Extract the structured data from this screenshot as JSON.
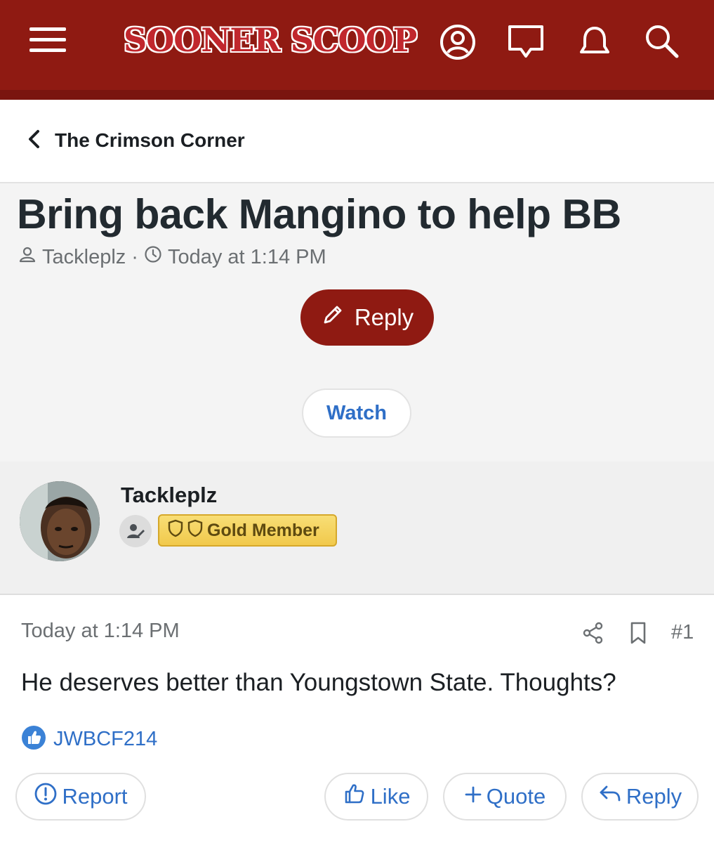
{
  "header": {
    "logo_text": "SOONER SCOOP",
    "brand_color": "#8f1a12",
    "icons": [
      "menu-icon",
      "account-icon",
      "messages-icon",
      "alerts-icon",
      "search-icon"
    ]
  },
  "breadcrumb": {
    "label": "The Crimson Corner"
  },
  "thread": {
    "title": "Bring back Mangino to help BB",
    "author": "Tackleplz",
    "separator": "·",
    "time": "Today at 1:14 PM",
    "reply_label": "Reply",
    "watch_label": "Watch"
  },
  "author_block": {
    "username": "Tackleplz",
    "badge_label": "Gold Member"
  },
  "post": {
    "date": "Today at 1:14 PM",
    "number": "#1",
    "body": "He deserves better than Youngstown State. Thoughts?",
    "reaction_user": "JWBCF214",
    "actions": {
      "report": "Report",
      "like": "Like",
      "quote": "Quote",
      "reply": "Reply"
    }
  }
}
